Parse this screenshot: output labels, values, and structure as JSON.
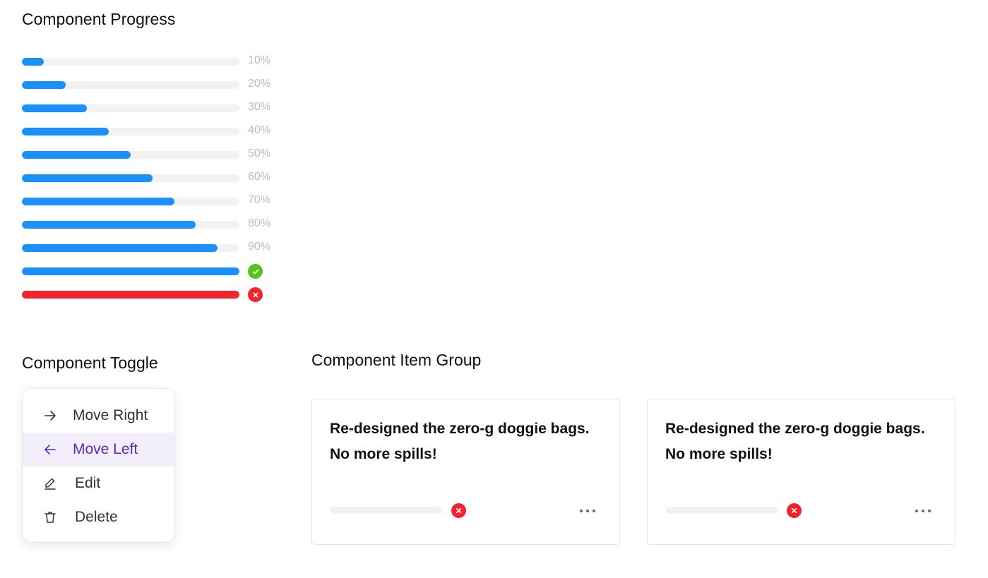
{
  "progress_section": {
    "title": "Component Progress",
    "bars": [
      {
        "value": 0.1,
        "label": "10%",
        "status": "normal"
      },
      {
        "value": 0.2,
        "label": "20%",
        "status": "normal"
      },
      {
        "value": 0.3,
        "label": "30%",
        "status": "normal"
      },
      {
        "value": 0.4,
        "label": "40%",
        "status": "normal"
      },
      {
        "value": 0.5,
        "label": "50%",
        "status": "normal"
      },
      {
        "value": 0.6,
        "label": "60%",
        "status": "normal"
      },
      {
        "value": 0.7,
        "label": "70%",
        "status": "normal"
      },
      {
        "value": 0.8,
        "label": "80%",
        "status": "normal"
      },
      {
        "value": 0.9,
        "label": "90%",
        "status": "normal"
      },
      {
        "value": 1.0,
        "label": "",
        "status": "success"
      },
      {
        "value": 1.0,
        "label": "",
        "status": "exception"
      }
    ],
    "colors": {
      "fill": "#1a90ff",
      "track": "#f2f2f2",
      "success": "#52c41a",
      "exception": "#f5222d"
    }
  },
  "toggle_section": {
    "title": "Component Toggle",
    "menu": [
      {
        "label": "Move Right",
        "icon": "arrow-right-icon",
        "active": false
      },
      {
        "label": "Move Left",
        "icon": "arrow-left-icon",
        "active": true
      },
      {
        "label": "Edit",
        "icon": "pencil-icon",
        "active": false
      },
      {
        "label": "Delete",
        "icon": "trash-icon",
        "active": false
      }
    ],
    "active_color": "#5b2bb5"
  },
  "item_group_section": {
    "title": "Component Item Group",
    "cards": [
      {
        "title": "Re-designed the zero-g doggie bags. No more spills!",
        "progress": 0,
        "status": "exception",
        "more_icon": "more-dots-icon"
      },
      {
        "title": "Re-designed the zero-g doggie bags. No more spills!",
        "progress": 0,
        "status": "exception",
        "more_icon": "more-dots-icon"
      }
    ]
  }
}
